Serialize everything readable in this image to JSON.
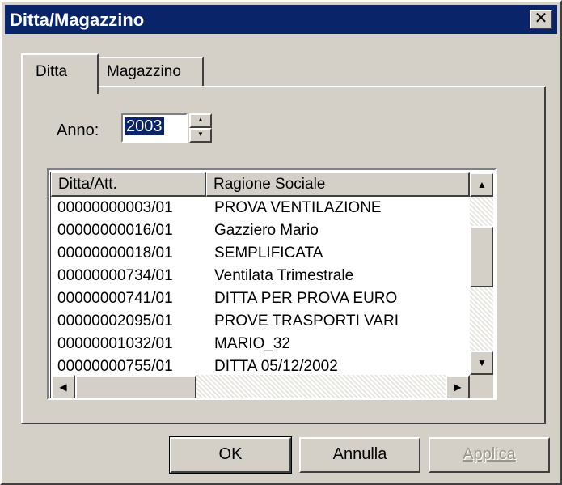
{
  "window": {
    "title": "Ditta/Magazzino",
    "close_glyph": "✕"
  },
  "tabs": [
    {
      "label": "Ditta",
      "active": true
    },
    {
      "label": "Magazzino",
      "active": false
    }
  ],
  "anno": {
    "label": "Anno:",
    "value": "2003"
  },
  "table": {
    "columns": [
      "Ditta/Att.",
      "Ragione Sociale"
    ],
    "rows": [
      [
        "00000000003/01",
        "PROVA VENTILAZIONE"
      ],
      [
        "00000000016/01",
        "Gazziero Mario"
      ],
      [
        "00000000018/01",
        "SEMPLIFICATA"
      ],
      [
        "00000000734/01",
        "Ventilata Trimestrale"
      ],
      [
        "00000000741/01",
        "DITTA PER PROVA EURO"
      ],
      [
        "00000002095/01",
        "PROVE TRASPORTI VARI"
      ],
      [
        "00000001032/01",
        "MARIO_32"
      ],
      [
        "00000000755/01",
        "DITTA 05/12/2002"
      ]
    ]
  },
  "buttons": {
    "ok": "OK",
    "annulla": "Annulla",
    "applica": "Applica"
  },
  "icons": {
    "close": "close-icon",
    "spin_up": "arrow-up-icon",
    "spin_down": "arrow-down-icon",
    "scroll_up": "arrow-up-icon",
    "scroll_down": "arrow-down-icon",
    "scroll_left": "arrow-left-icon",
    "scroll_right": "arrow-right-icon"
  },
  "colors": {
    "titlebar": "#0a246a",
    "face": "#d4d0c8",
    "selection": "#0a246a"
  }
}
